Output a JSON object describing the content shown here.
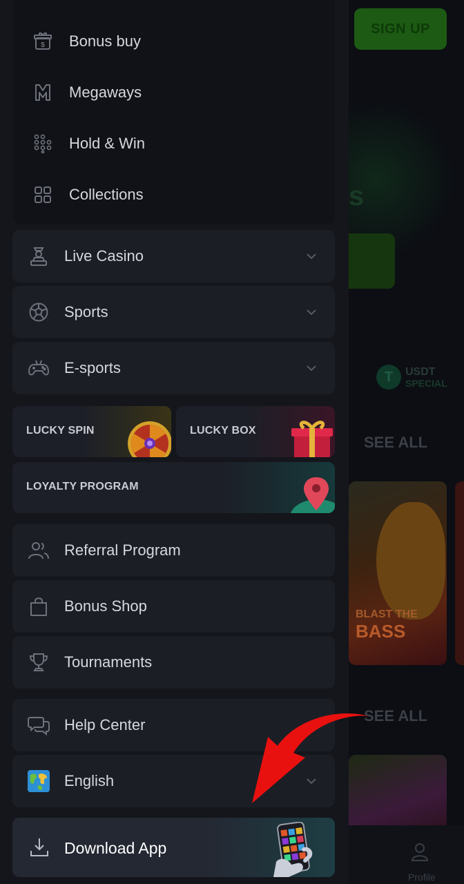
{
  "background_page": {
    "signup_label": "SIGN UP",
    "hero_fragment": "s",
    "usdt_badge": {
      "title": "USDT",
      "subtitle": "SPECIAL"
    },
    "see_all_top": "SEE ALL",
    "see_all_bottom": "SEE ALL",
    "game_card_caption_small": "BLAST THE",
    "game_card_caption_big": "BASS",
    "bottom_nav_profile": "Profile"
  },
  "drawer": {
    "sub_items": [
      {
        "label": "Bonus buy",
        "icon": "gift-dollar-icon"
      },
      {
        "label": "Megaways",
        "icon": "megaways-icon"
      },
      {
        "label": "Hold & Win",
        "icon": "dots-grid-icon"
      },
      {
        "label": "Collections",
        "icon": "collections-grid-icon"
      }
    ],
    "sections": [
      {
        "label": "Live Casino",
        "icon": "dealer-icon"
      },
      {
        "label": "Sports",
        "icon": "soccer-ball-icon"
      },
      {
        "label": "E-sports",
        "icon": "gamepad-icon"
      }
    ],
    "promos": {
      "lucky_spin": "LUCKY SPIN",
      "lucky_box": "LUCKY BOX",
      "loyalty_program": "LOYALTY PROGRAM"
    },
    "links": [
      {
        "label": "Referral Program",
        "icon": "users-icon"
      },
      {
        "label": "Bonus Shop",
        "icon": "shopping-bag-icon"
      },
      {
        "label": "Tournaments",
        "icon": "trophy-icon"
      }
    ],
    "help_center": {
      "label": "Help Center",
      "icon": "chat-bubbles-icon"
    },
    "language": {
      "label": "English",
      "icon": "globe-flag-icon"
    },
    "download_app": {
      "label": "Download App",
      "icon": "download-icon"
    }
  },
  "colors": {
    "drawer_bg": "#14161c",
    "row_bg": "#1b1e25",
    "text": "#d6d8de",
    "annotation_arrow": "#e8110f"
  }
}
